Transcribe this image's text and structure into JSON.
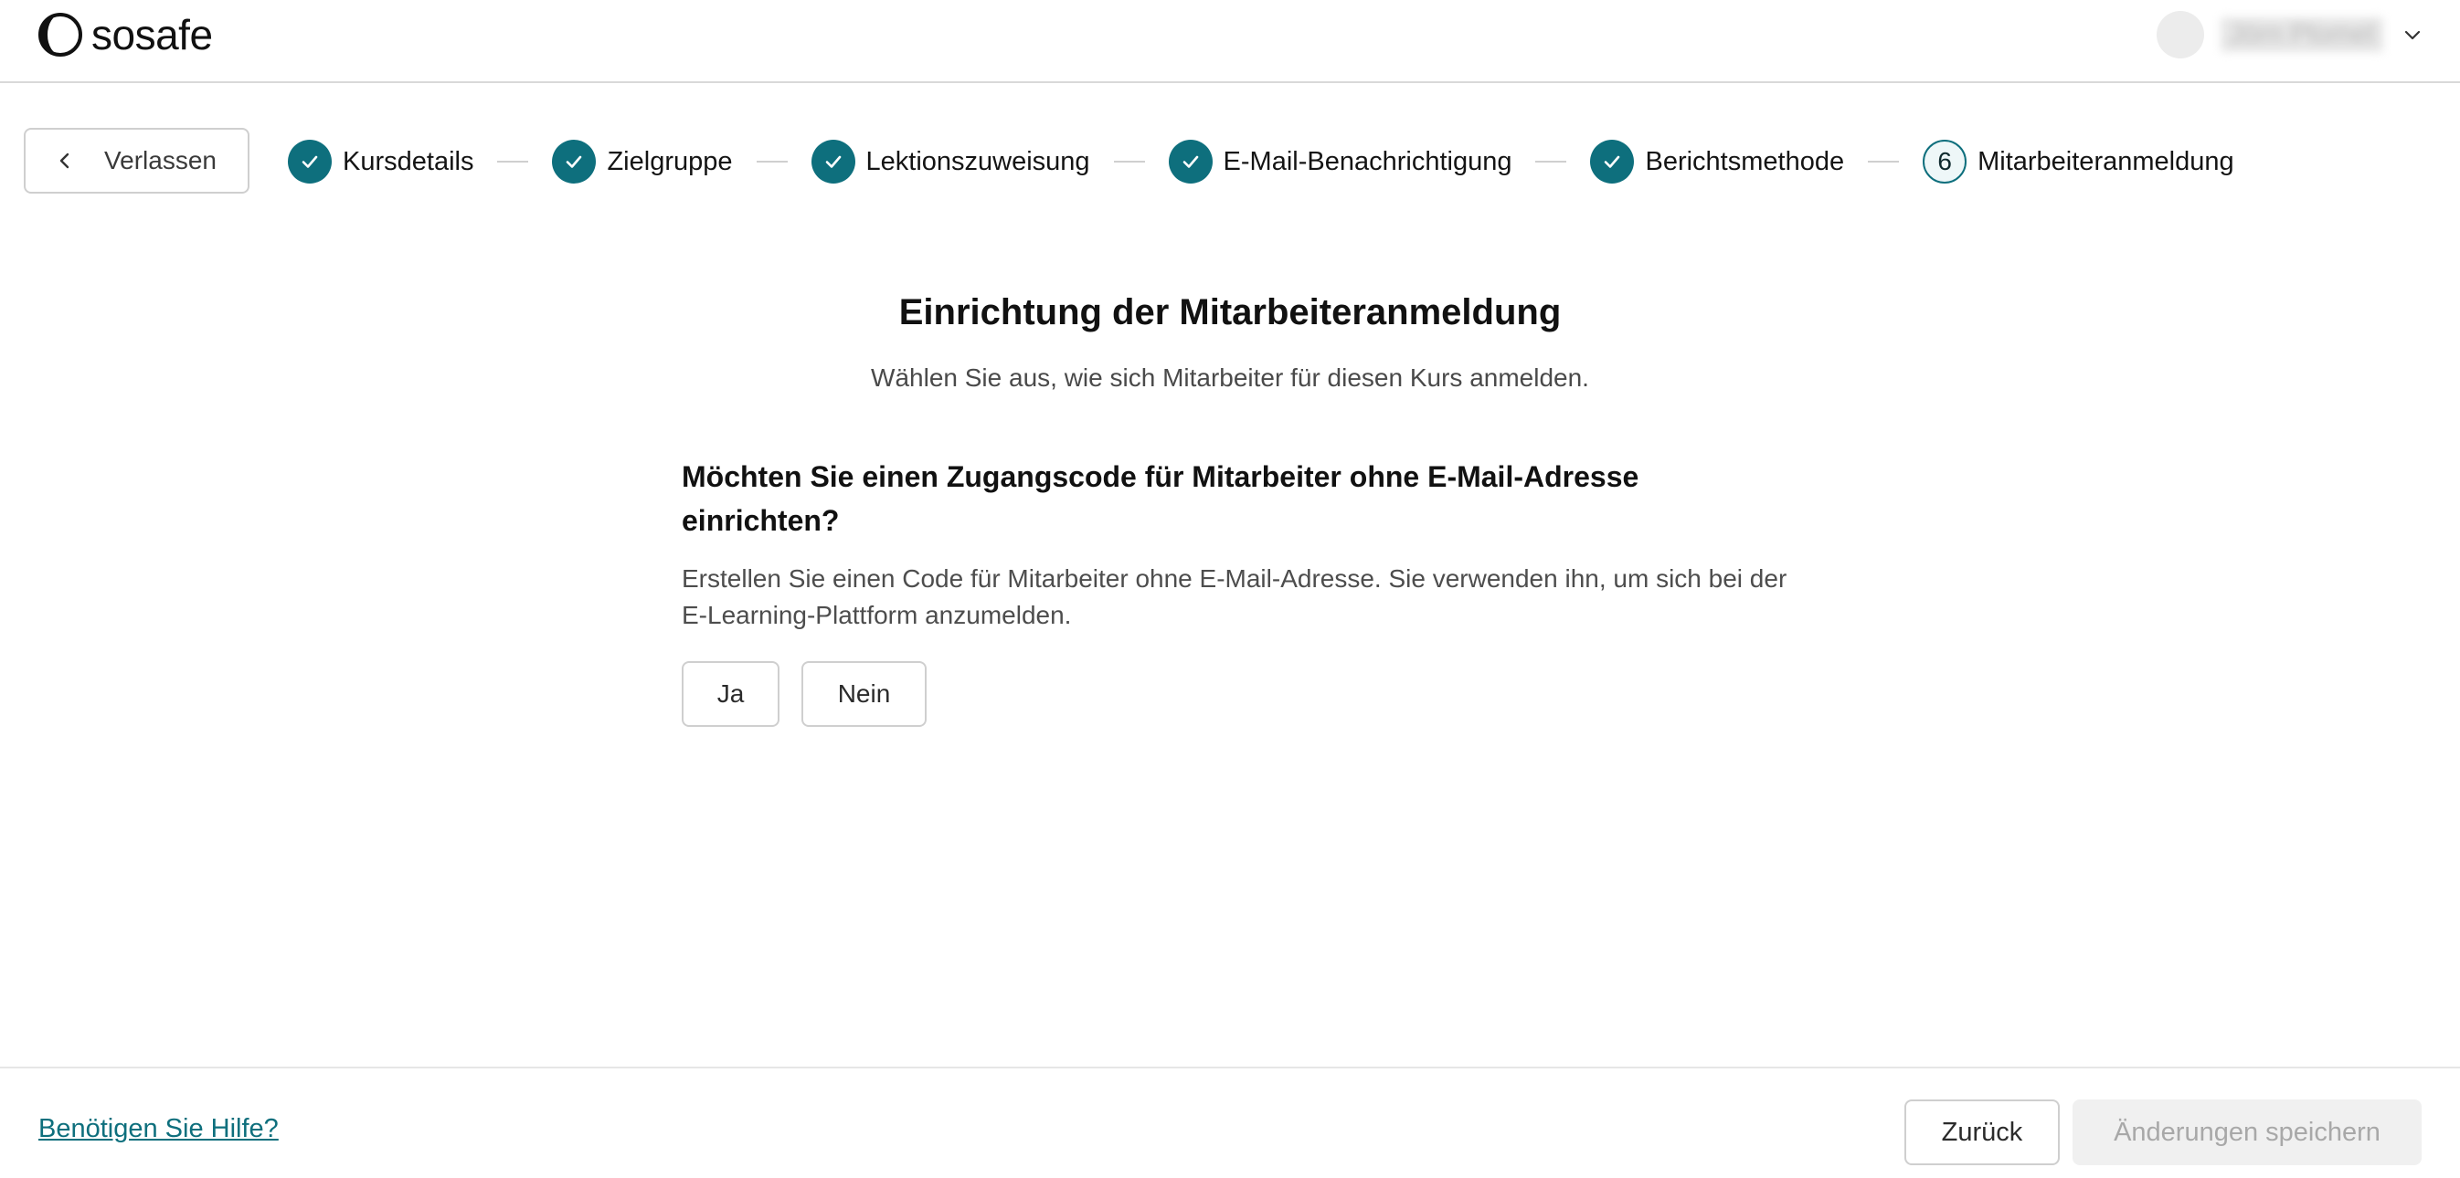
{
  "header": {
    "logo_text": "sosafe",
    "user_name": "Jörn Plomel",
    "icons": [
      "sosafe-logo-icon",
      "user-avatar",
      "chevron-down-icon"
    ]
  },
  "stepper": {
    "leave_label": "Verlassen",
    "steps": [
      {
        "label": "Kursdetails",
        "state": "completed"
      },
      {
        "label": "Zielgruppe",
        "state": "completed"
      },
      {
        "label": "Lektionszuweisung",
        "state": "completed"
      },
      {
        "label": "E-Mail-Benachrichtigung",
        "state": "completed"
      },
      {
        "label": "Berichtsmethode",
        "state": "completed"
      },
      {
        "label": "Mitarbeiteranmeldung",
        "state": "current",
        "number": "6"
      }
    ]
  },
  "main": {
    "title": "Einrichtung der Mitarbeiteranmeldung",
    "subtitle": "Wählen Sie aus, wie sich Mitarbeiter für diesen Kurs anmelden.",
    "question": {
      "title": "Möchten Sie einen Zugangscode für Mitarbeiter ohne E-Mail-Adresse einrichten?",
      "description": "Erstellen Sie einen Code für Mitarbeiter ohne E-Mail-Adresse. Sie verwenden ihn, um sich bei der E-Learning-Plattform anzumelden.",
      "yes_label": "Ja",
      "no_label": "Nein"
    }
  },
  "footer": {
    "help_label": "Benötigen Sie Hilfe?",
    "back_label": "Zurück",
    "save_label": "Änderungen speichern",
    "save_disabled": true
  },
  "colors": {
    "accent": "#0e6f7d",
    "border": "#cfcfcf",
    "disabled_bg": "#f0f0f0",
    "disabled_text": "#a8a8a8"
  }
}
